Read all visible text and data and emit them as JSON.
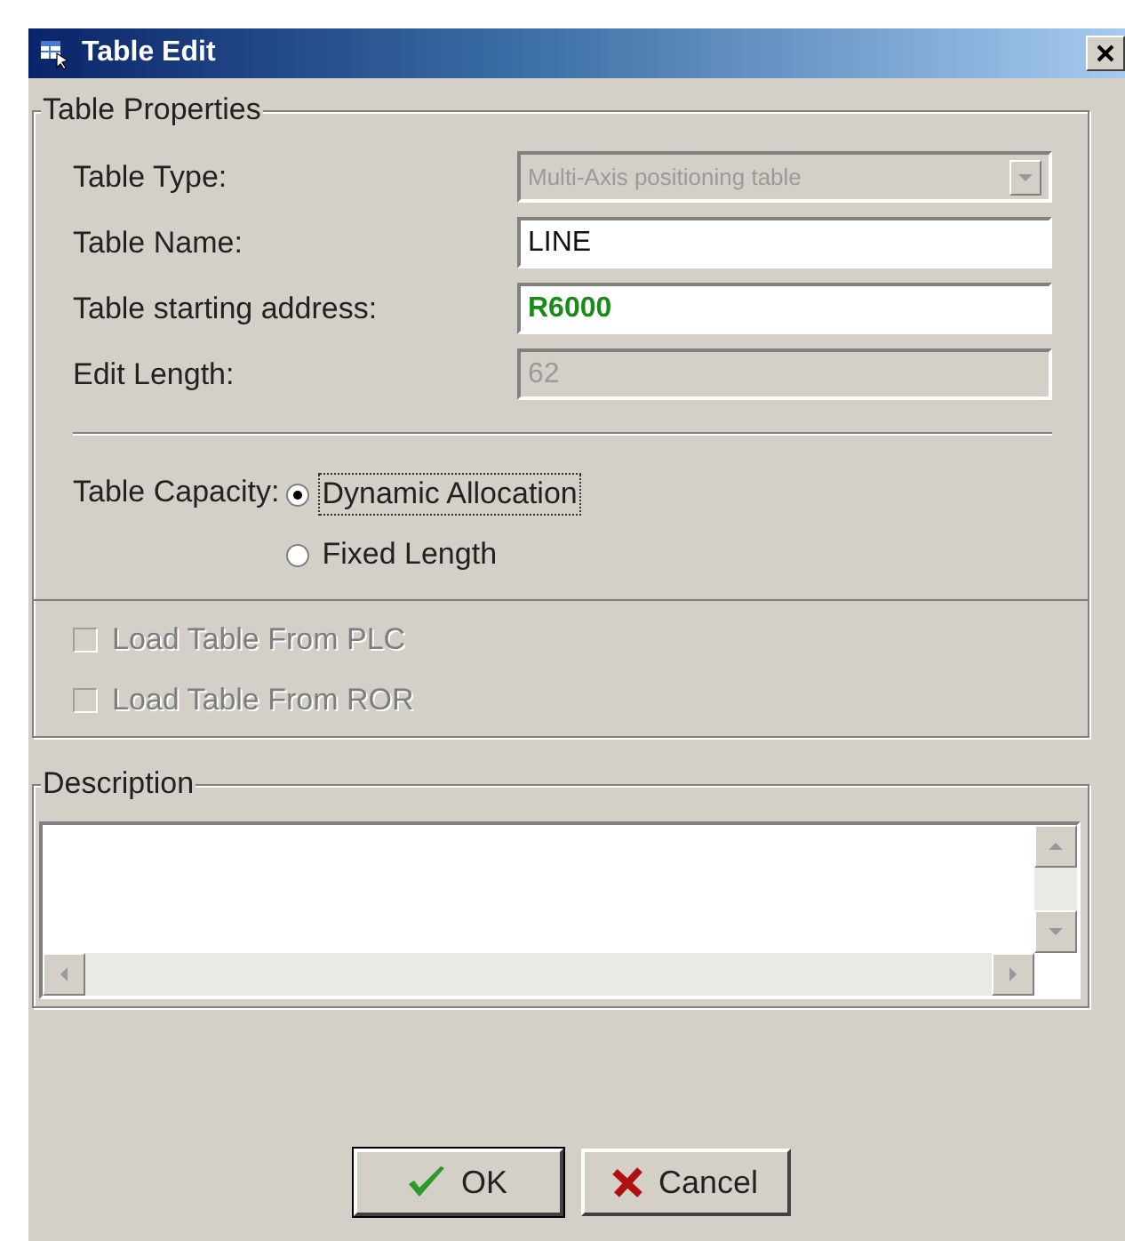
{
  "window": {
    "title": "Table Edit"
  },
  "properties": {
    "legend": "Table Properties",
    "fields": [
      {
        "label": "Table Type:",
        "kind": "select",
        "value": "Multi-Axis positioning table",
        "disabled": true
      },
      {
        "label": "Table Name:",
        "kind": "text",
        "value": "LINE",
        "disabled": false
      },
      {
        "label": "Table starting address:",
        "kind": "address",
        "value": "R6000",
        "disabled": false
      },
      {
        "label": "Edit Length:",
        "kind": "text",
        "value": "62",
        "disabled": true
      }
    ],
    "capacity": {
      "label": "Table Capacity:",
      "options": [
        {
          "label": "Dynamic Allocation",
          "selected": true,
          "focused": true
        },
        {
          "label": "Fixed Length",
          "selected": false,
          "focused": false
        }
      ]
    },
    "checkboxes": [
      {
        "label": "Load Table From PLC",
        "checked": false,
        "disabled": true
      },
      {
        "label": "Load Table From ROR",
        "checked": false,
        "disabled": true
      }
    ]
  },
  "description": {
    "legend": "Description"
  },
  "buttons": [
    {
      "label": "OK",
      "kind": "ok"
    },
    {
      "label": "Cancel",
      "kind": "cancel"
    }
  ]
}
